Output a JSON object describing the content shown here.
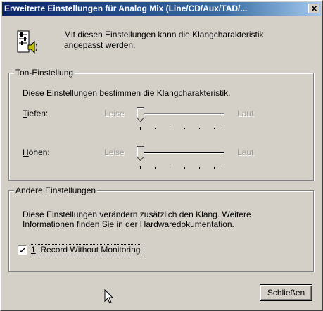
{
  "window": {
    "title": "Erweiterte Einstellungen für Analog Mix (Line/CD/Aux/TAD/...",
    "close_glyph": "✕"
  },
  "intro": {
    "icon": "speaker-settings-icon",
    "text": "Mit diesen Einstellungen kann die Klangcharakteristik angepasst werden."
  },
  "tone": {
    "title": "Ton-Einstellung",
    "description": "Diese Einstellungen bestimmen die Klangcharakteristik.",
    "sliders": [
      {
        "label_hot": "T",
        "label_rest": "iefen:",
        "min_label": "Leise",
        "max_label": "Laut",
        "value": 0
      },
      {
        "label_hot": "H",
        "label_rest": "öhen:",
        "min_label": "Leise",
        "max_label": "Laut",
        "value": 0
      }
    ]
  },
  "other": {
    "title": "Andere Einstellungen",
    "description_line1": "Diese Einstellungen verändern zusätzlich den Klang. Weitere",
    "description_line2": "Informationen finden Sie in der Hardwaredokumentation.",
    "checkbox": {
      "label_hot": "1",
      "label_rest": "  Record Without Monitoring",
      "checked": true
    }
  },
  "buttons": {
    "close_label": "Schließen"
  },
  "colors": {
    "titlebar_start": "#0a246a",
    "titlebar_end": "#a6caf0",
    "face": "#d4d0c8"
  }
}
